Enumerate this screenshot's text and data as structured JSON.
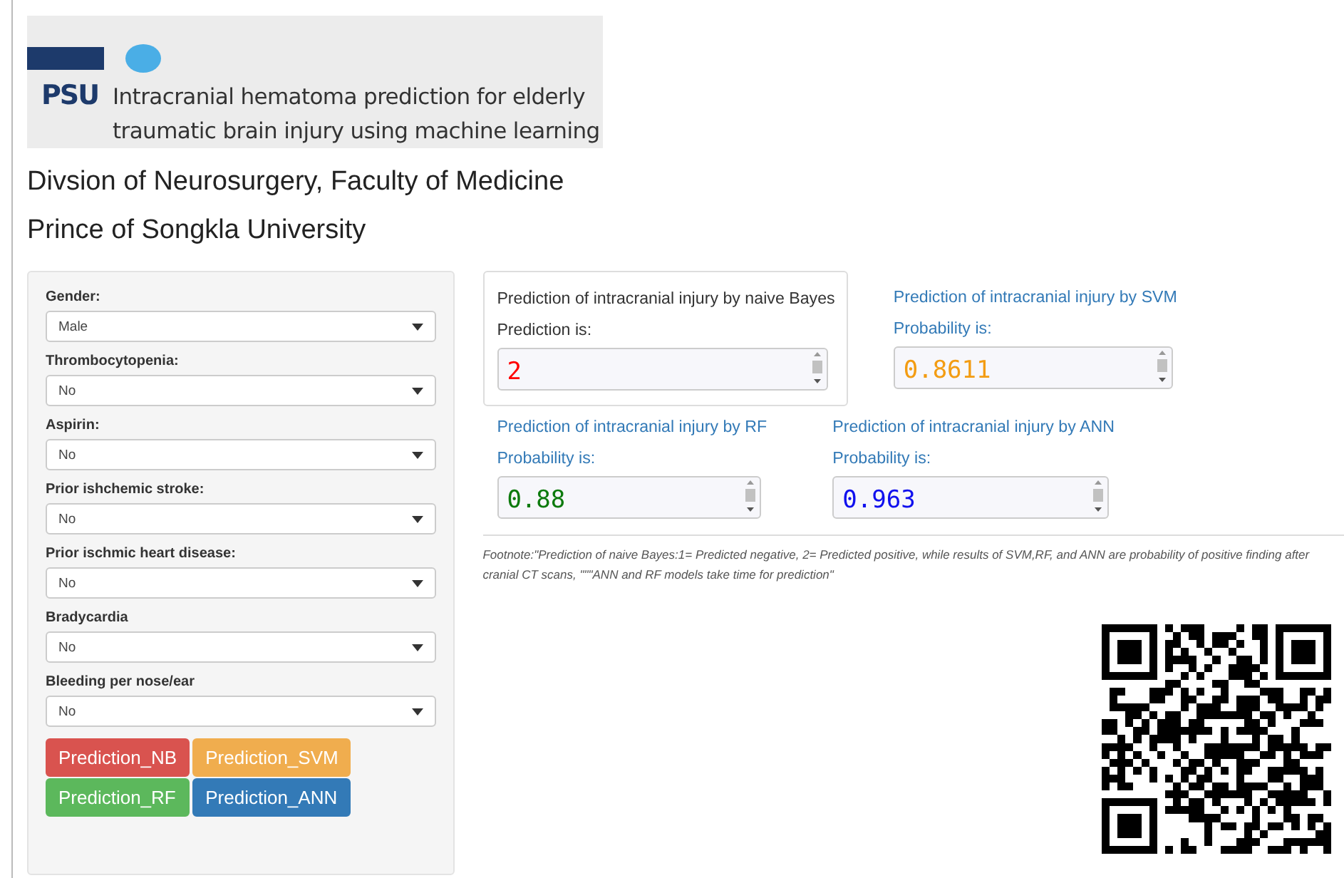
{
  "banner": {
    "logo_text": "PSU",
    "title_lines": [
      "Intracranial hematoma prediction for elderly",
      "traumatic brain injury using machine learning"
    ]
  },
  "headings": [
    "Divsion of Neurosurgery, Faculty of Medicine",
    "Prince of Songkla University"
  ],
  "inputs": [
    {
      "label": "Gender:",
      "value": "Male"
    },
    {
      "label": "Thrombocytopenia:",
      "value": "No"
    },
    {
      "label": "Aspirin:",
      "value": "No"
    },
    {
      "label": "Prior ishchemic stroke:",
      "value": "No"
    },
    {
      "label": "Prior ischmic heart disease:",
      "value": "No"
    },
    {
      "label": "Bradycardia",
      "value": "No"
    },
    {
      "label": "Bleeding per nose/ear",
      "value": "No"
    }
  ],
  "buttons": [
    {
      "label": "Prediction_NB",
      "color": "#d9534f"
    },
    {
      "label": "Prediction_SVM",
      "color": "#f0ad4e"
    },
    {
      "label": "Prediction_RF",
      "color": "#5cb85c"
    },
    {
      "label": "Prediction_ANN",
      "color": "#337ab7"
    }
  ],
  "outputs": [
    {
      "kind": "boxed",
      "title": "Prediction of intracranial injury by naive Bayes",
      "caption": "Prediction is:",
      "value": "2",
      "color": "#ff0000"
    },
    {
      "kind": "plain",
      "title": "Prediction of intracranial injury by SVM",
      "caption": "Probability is:",
      "value": "0.8611",
      "color": "#f39c12"
    },
    {
      "kind": "plain",
      "title": "Prediction of intracranial injury by RF",
      "caption": "Probability is:",
      "value": "0.88",
      "color": "#0d7a0d"
    },
    {
      "kind": "plain",
      "title": "Prediction of intracranial injury by ANN",
      "caption": "Probability is:",
      "value": "0.963",
      "color": "#1010ee"
    }
  ],
  "footnote": "Footnote:\"Prediction of naive Bayes:1= Predicted negative, 2= Predicted positive, while results of SVM,RF, and ANN are probability of positive finding after cranial CT scans, \"\"\"ANN and RF models take time for prediction\""
}
